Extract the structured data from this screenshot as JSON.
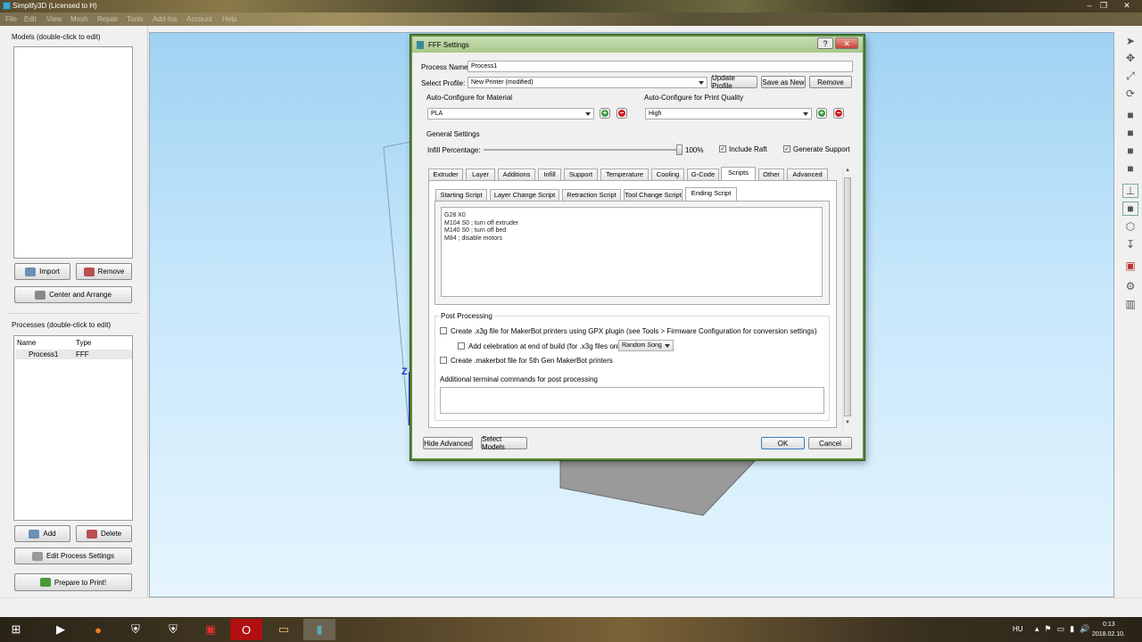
{
  "window": {
    "title": "Simplify3D (Licensed to H)"
  },
  "menu": [
    "File",
    "Edit",
    "View",
    "Mesh",
    "Repair",
    "Tools",
    "Add-Ins",
    "Account",
    "Help"
  ],
  "left": {
    "models_label": "Models (double-click to edit)",
    "import_label": "Import",
    "remove_label": "Remove",
    "center_label": "Center and Arrange",
    "processes_label": "Processes (double-click to edit)",
    "col_name": "Name",
    "col_type": "Type",
    "process_rows": [
      {
        "name": "Process1",
        "type": "FFF"
      }
    ],
    "add_label": "Add",
    "delete_label": "Delete",
    "edit_label": "Edit Process Settings",
    "prepare_label": "Prepare to Print!"
  },
  "viewport": {
    "axis_label": "Z"
  },
  "dialog": {
    "title": "FFF Settings",
    "help": "?",
    "process_name_label": "Process Name:",
    "process_name_value": "Process1",
    "select_profile_label": "Select Profile:",
    "profile_value": "New Printer (modified)",
    "update_profile": "Update Profile",
    "save_as_new": "Save as New",
    "remove": "Remove",
    "material_label": "Auto-Configure for Material",
    "material_value": "PLA",
    "quality_label": "Auto-Configure for Print Quality",
    "quality_value": "High",
    "general_label": "General Settings",
    "infill_label": "Infill Percentage:",
    "infill_value": "100%",
    "infill_level": 1.0,
    "include_raft": "Include Raft",
    "include_raft_checked": true,
    "generate_support": "Generate Support",
    "generate_support_checked": true,
    "tabs": [
      "Extruder",
      "Layer",
      "Additions",
      "Infill",
      "Support",
      "Temperature",
      "Cooling",
      "G-Code",
      "Scripts",
      "Other",
      "Advanced"
    ],
    "active_tab": "Scripts",
    "script_tabs": [
      "Starting Script",
      "Layer Change Script",
      "Retraction Script",
      "Tool Change Script",
      "Ending Script"
    ],
    "active_script_tab": "Ending Script",
    "script_lines": [
      "G28 X0",
      "M104 S0 ; turn off extruder",
      "M140 S0 ; turn off bed",
      "M84 ; disable motors"
    ],
    "post_label": "Post Processing",
    "x3g_label": "Create .x3g file for MakerBot printers using GPX plugin (see Tools > Firmware Configuration for conversion settings)",
    "celebration_label": "Add celebration at end of build (for .x3g files only)",
    "song_value": "Random Song",
    "makerbot_label": "Create .makerbot file for 5th Gen MakerBot printers",
    "terminal_label": "Additional terminal commands for post processing",
    "hide_advanced": "Hide Advanced",
    "select_models": "Select Models",
    "ok": "OK",
    "cancel": "Cancel"
  },
  "taskbar": {
    "lang": "HU",
    "time": "0:13",
    "date": "2018.02.10."
  }
}
